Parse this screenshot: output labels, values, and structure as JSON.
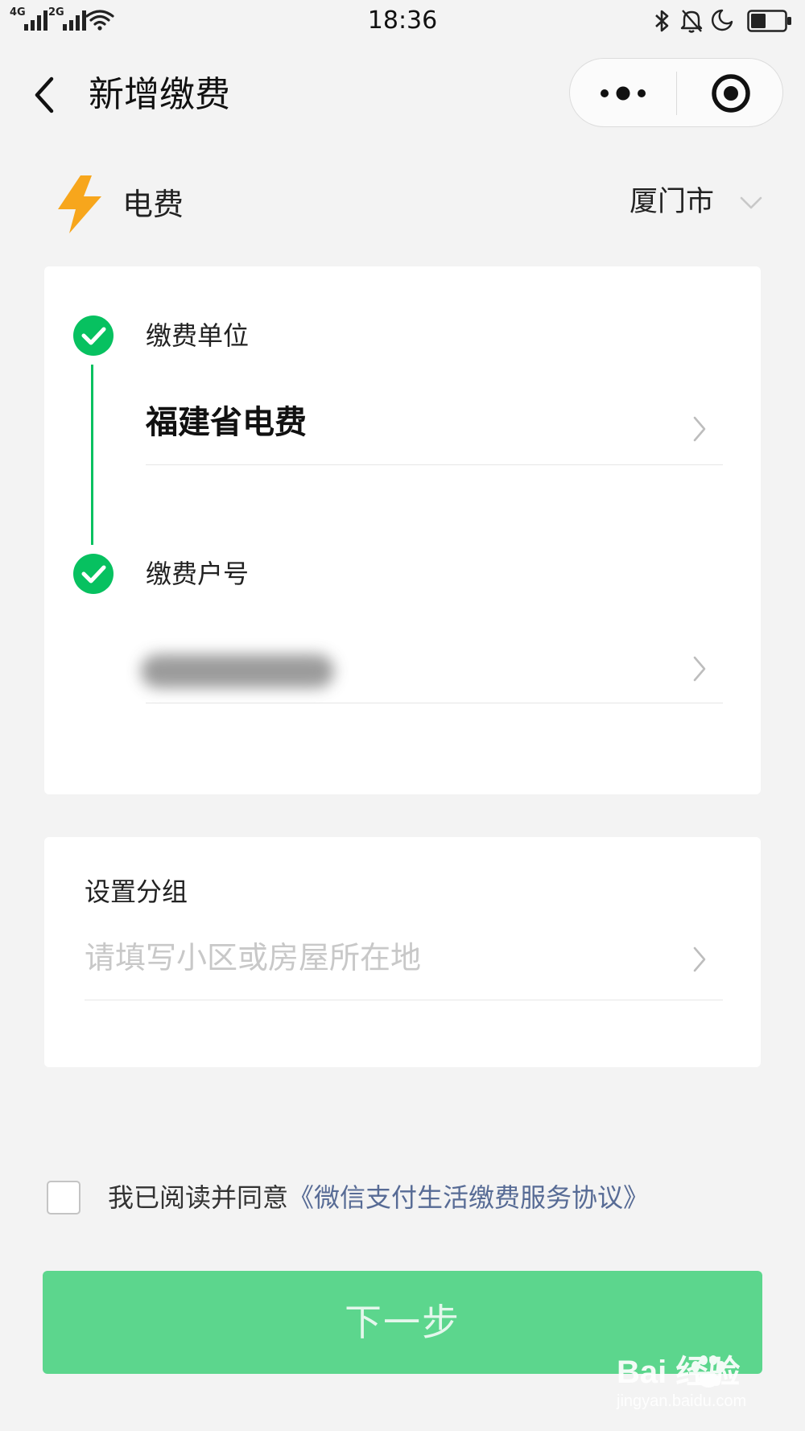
{
  "status_bar": {
    "time": "18:36",
    "sim1_label": "4G",
    "sim2_label": "2G",
    "icons": [
      "signal-icon",
      "signal-icon",
      "wifi-icon",
      "bluetooth-icon",
      "bell-off-icon",
      "moon-icon",
      "battery-icon"
    ],
    "battery_level": 0.45
  },
  "nav": {
    "title": "新增缴费",
    "back_icon": "chevron-left-icon",
    "more_icon": "more-dots-icon",
    "record_icon": "target-circle-icon"
  },
  "category": {
    "icon": "lightning-bolt-icon",
    "label": "电费",
    "city": "厦门市",
    "city_dropdown_icon": "chevron-down-icon"
  },
  "steps": [
    {
      "label": "缴费单位",
      "value": "福建省电费",
      "completed": true
    },
    {
      "label": "缴费户号",
      "value": "",
      "blurred": true,
      "completed": true
    }
  ],
  "group": {
    "label": "设置分组",
    "placeholder": "请填写小区或房屋所在地",
    "value": ""
  },
  "agreement": {
    "checked": false,
    "text": "我已阅读并同意",
    "link": "《微信支付生活缴费服务协议》"
  },
  "next_button": {
    "label": "下一步",
    "enabled": false
  },
  "watermark": {
    "main": "Bai 经验",
    "sub": "jingyan.baidu.com"
  },
  "colors": {
    "accent_green": "#07c160",
    "button_disabled_green": "#5cd68d",
    "link_blue": "#576b95",
    "bolt_orange": "#f7a61c",
    "background": "#f3f3f3"
  }
}
